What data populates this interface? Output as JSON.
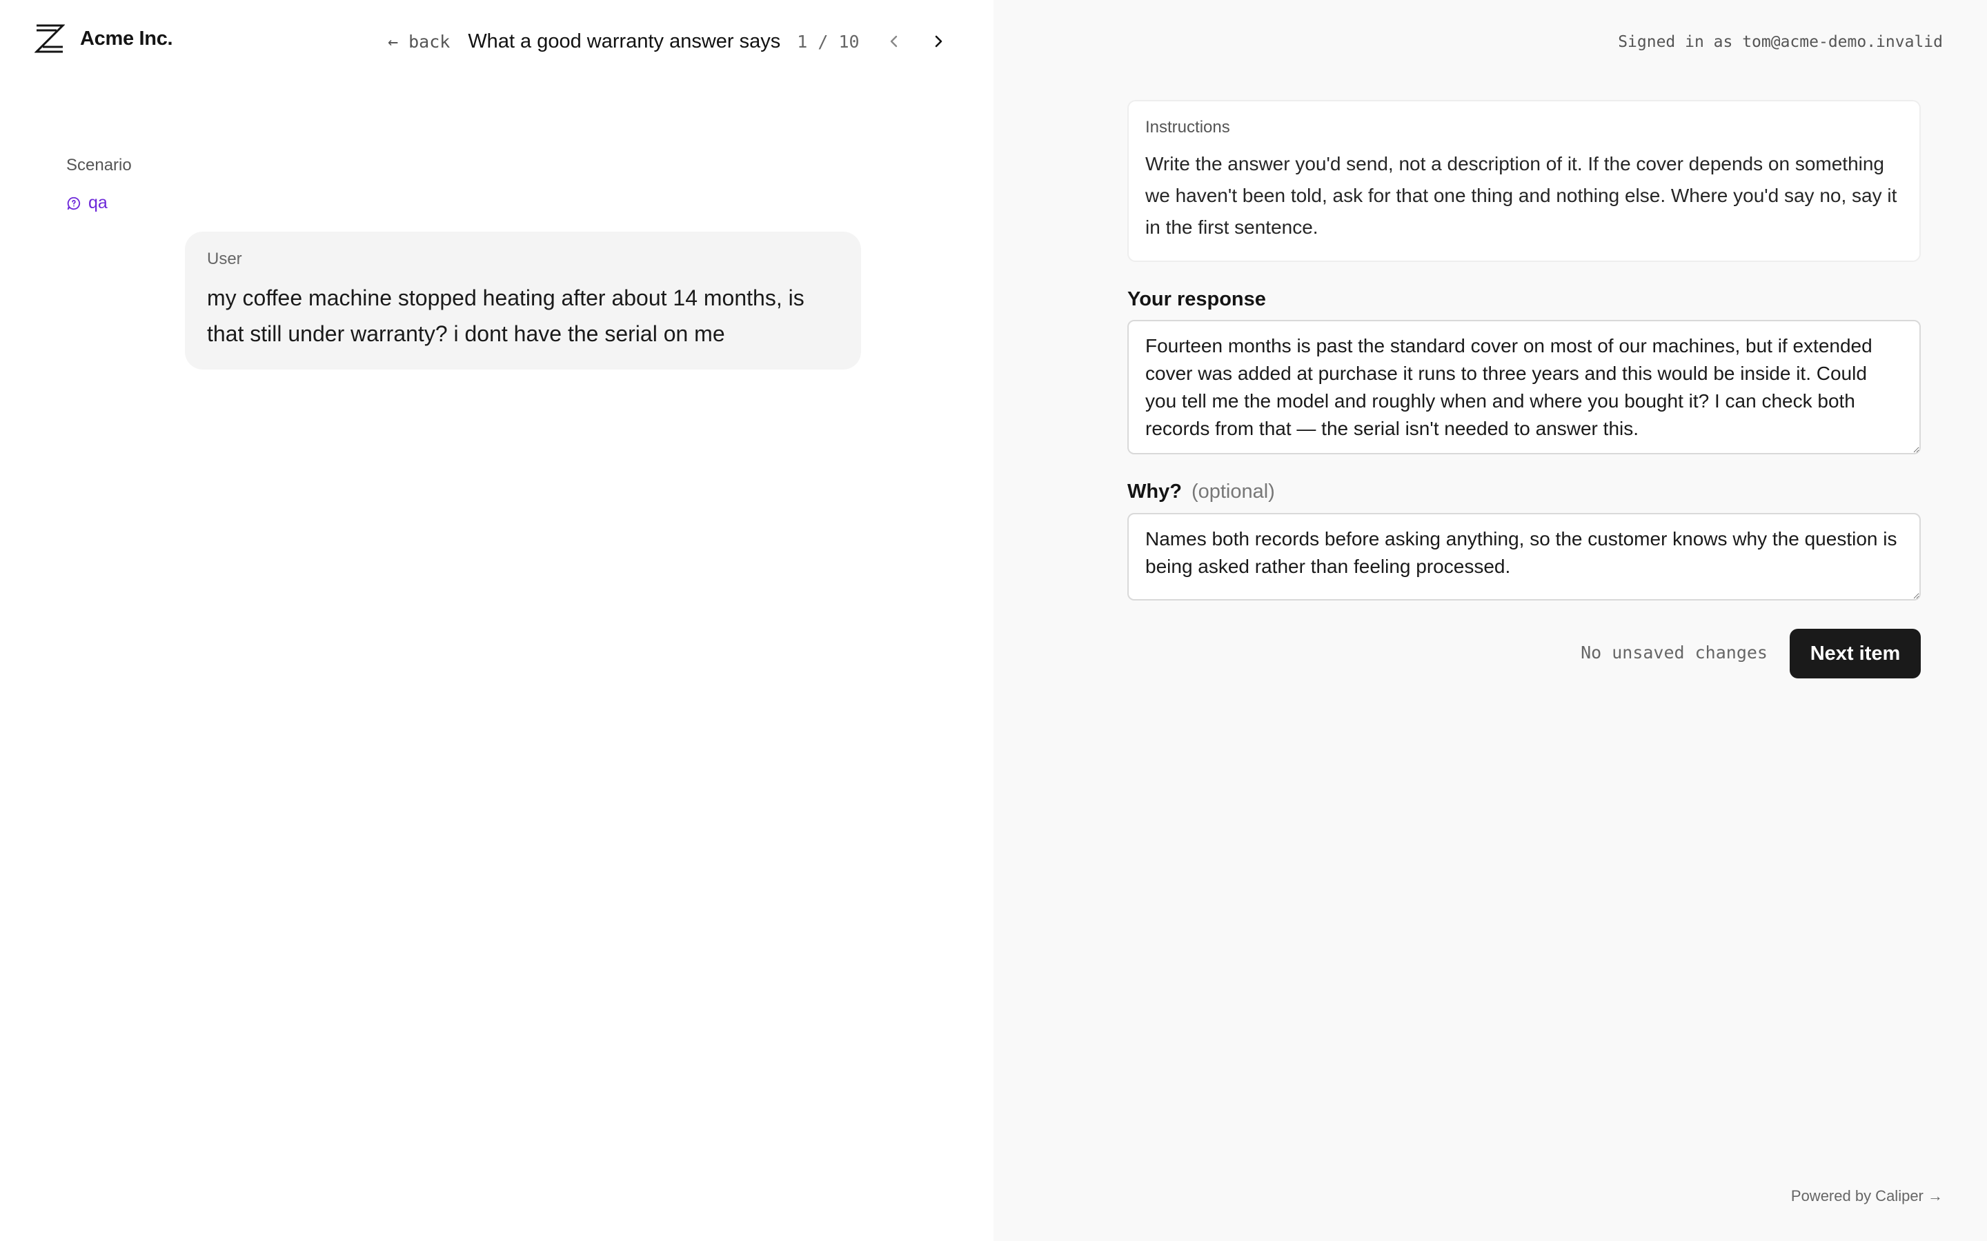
{
  "brand": {
    "name": "Acme Inc.",
    "logo_icon": "z-logo-icon"
  },
  "topnav": {
    "back_label": "← back",
    "item_title": "What a good warranty answer says",
    "counter": "1 / 10",
    "prev_icon": "chevron-left-icon",
    "next_icon": "chevron-right-icon"
  },
  "scenario": {
    "label": "Scenario",
    "tag_icon": "chat-bubble-icon",
    "tag": "qa"
  },
  "conversation": {
    "role": "User",
    "message": "my coffee machine stopped heating after about 14 months, is that still under warranty? i dont have the serial on me"
  },
  "account": {
    "signed_in_text": "Signed in as tom@acme-demo.invalid"
  },
  "instructions": {
    "label": "Instructions",
    "text": "Write the answer you'd send, not a description of it. If the cover depends on something we haven't been told, ask for that one thing and nothing else. Where you'd say no, say it in the first sentence."
  },
  "response_field": {
    "label": "Your response",
    "value": "Fourteen months is past the standard cover on most of our machines, but if extended cover was added at purchase it runs to three years and this would be inside it. Could you tell me the model and roughly when and where you bought it? I can check both records from that — the serial isn't needed to answer this."
  },
  "why_field": {
    "label": "Why?",
    "optional_label": "(optional)",
    "value": "Names both records before asking anything, so the customer knows why the question is being asked rather than feeling processed."
  },
  "footer_actions": {
    "save_status": "No unsaved changes",
    "next_label": "Next item"
  },
  "powered_by": "Powered by Caliper →",
  "colors": {
    "accent_purple": "#6d28d9",
    "primary_button": "#1a1a1a",
    "right_pane_bg": "#f9f9f9",
    "bubble_bg": "#f4f4f4"
  }
}
